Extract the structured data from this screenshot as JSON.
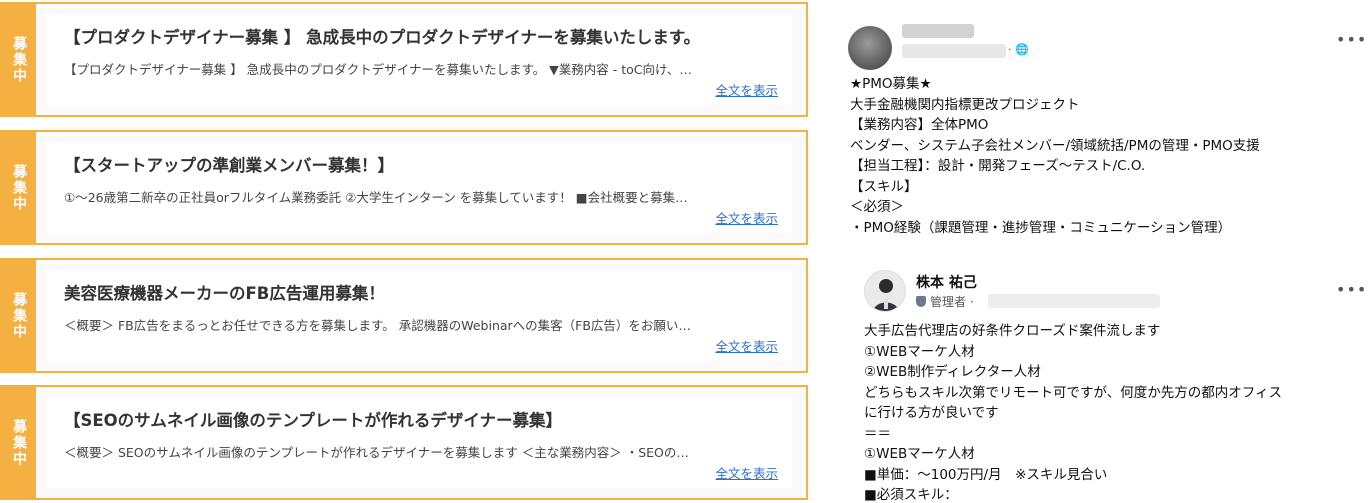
{
  "job_cards": [
    {
      "tag": "募集中",
      "title": "【プロダクトデザイナー募集 】 急成長中のプロダクトデザイナーを募集いたします。",
      "desc": "【プロダクトデザイナー募集 】 急成長中のプロダクトデザイナーを募集いたします。 ▼業務内容 - toC向け、…",
      "more": "全文を表示"
    },
    {
      "tag": "募集中",
      "title": "【スタートアップの準創業メンバー募集！】",
      "desc": "①～26歳第二新卒の正社員orフルタイム業務委託 ②大学生インターン を募集しています！ ■会社概要と募集…",
      "more": "全文を表示"
    },
    {
      "tag": "募集中",
      "title": "美容医療機器メーカーのFB広告運用募集！",
      "desc": "＜概要＞ FB広告をまるっとお任せできる方を募集します。 承認機器のWebinarへの集客（FB広告）をお願い…",
      "more": "全文を表示"
    },
    {
      "tag": "募集中",
      "title": "【SEOのサムネイル画像のテンプレートが作れるデザイナー募集】",
      "desc": "＜概要＞ SEOのサムネイル画像のテンプレートが作れるデザイナーを募集します ＜主な業務内容＞ ・SEOの…",
      "more": "全文を表示"
    }
  ],
  "post1": {
    "more_icon": "•••",
    "globe": "· 🌐",
    "body": "★PMO募集★\n大手金融機関内指標更改プロジェクト\n【業務内容】全体PMO\nベンダー、システム子会社メンバー/領域統括/PMの管理・PMO支援\n【担当工程】：設計・開発フェーズ～テスト/C.O.\n【スキル】\n＜必須＞\n・PMO経験（課題管理・進捗管理・コミュニケーション管理）"
  },
  "post2": {
    "author": "株本 祐己",
    "role": "管理者 ·",
    "more_icon": "•••",
    "body": "大手広告代理店の好条件クローズド案件流します\n①WEBマーケ人材\n②WEB制作ディレクター人材\nどちらもスキル次第でリモート可ですが、何度か先方の都内オフィス\nに行ける方が良いです\n＝＝\n①WEBマーケ人材\n■単価：～100万円/月　※スキル見合い\n■必須スキル："
  },
  "colors": {
    "accent": "#f5b042",
    "link": "#2a6fd6"
  }
}
